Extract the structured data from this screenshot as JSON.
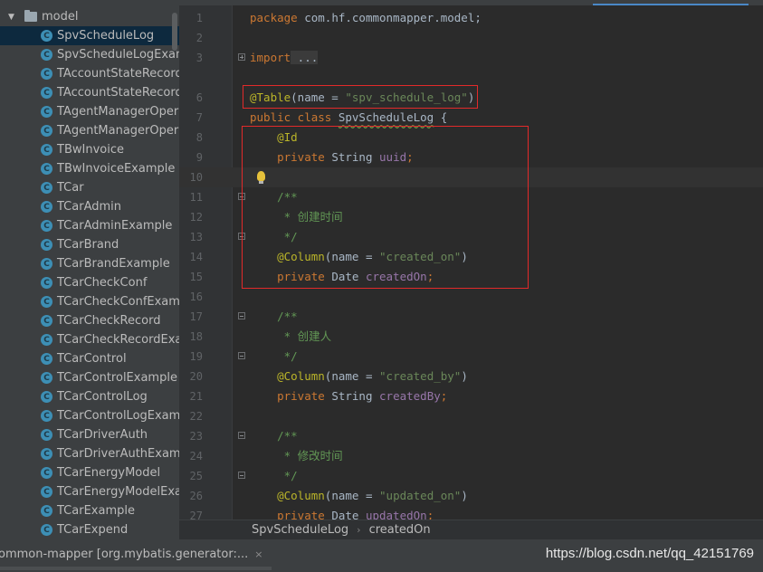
{
  "sidebar": {
    "folder": "model",
    "items": [
      {
        "name": "SpvScheduleLog",
        "selected": true
      },
      {
        "name": "SpvScheduleLogExample",
        "selected": false
      },
      {
        "name": "TAccountStateRecord",
        "selected": false
      },
      {
        "name": "TAccountStateRecordExample",
        "selected": false
      },
      {
        "name": "TAgentManagerOperateLog",
        "selected": false
      },
      {
        "name": "TAgentManagerOperateLogExample",
        "selected": false
      },
      {
        "name": "TBwInvoice",
        "selected": false
      },
      {
        "name": "TBwInvoiceExample",
        "selected": false
      },
      {
        "name": "TCar",
        "selected": false
      },
      {
        "name": "TCarAdmin",
        "selected": false
      },
      {
        "name": "TCarAdminExample",
        "selected": false
      },
      {
        "name": "TCarBrand",
        "selected": false
      },
      {
        "name": "TCarBrandExample",
        "selected": false
      },
      {
        "name": "TCarCheckConf",
        "selected": false
      },
      {
        "name": "TCarCheckConfExample",
        "selected": false
      },
      {
        "name": "TCarCheckRecord",
        "selected": false
      },
      {
        "name": "TCarCheckRecordExample",
        "selected": false
      },
      {
        "name": "TCarControl",
        "selected": false
      },
      {
        "name": "TCarControlExample",
        "selected": false
      },
      {
        "name": "TCarControlLog",
        "selected": false
      },
      {
        "name": "TCarControlLogExample",
        "selected": false
      },
      {
        "name": "TCarDriverAuth",
        "selected": false
      },
      {
        "name": "TCarDriverAuthExample",
        "selected": false
      },
      {
        "name": "TCarEnergyModel",
        "selected": false
      },
      {
        "name": "TCarEnergyModelExample",
        "selected": false
      },
      {
        "name": "TCarExample",
        "selected": false
      },
      {
        "name": "TCarExpend",
        "selected": false
      }
    ],
    "class_icon_letter": "C"
  },
  "code": {
    "line_numbers": [
      "1",
      "2",
      "3",
      "6",
      "7",
      "8",
      "9",
      "10",
      "11",
      "12",
      "13",
      "14",
      "15",
      "16",
      "17",
      "18",
      "19",
      "20",
      "21",
      "22",
      "23",
      "24",
      "25",
      "26",
      "27"
    ],
    "l1": {
      "kw": "package",
      "rest": " com.hf.commonmapper.model;"
    },
    "l3": {
      "kw": "import",
      "rest": " ..."
    },
    "l6": {
      "ann": "@Table",
      "open": "(name = ",
      "str": "\"spv_schedule_log\"",
      "close": ")"
    },
    "l7": {
      "kw": "public class",
      "space": " ",
      "cls": "SpvScheduleLog",
      "rest": " {"
    },
    "l8": {
      "ann": "@Id"
    },
    "l9": {
      "kw": "private",
      "type": " String ",
      "fld": "uuid",
      "end": ";"
    },
    "l11": {
      "cmt": "/**"
    },
    "l12": {
      "cmt": " * 创建时间"
    },
    "l13": {
      "cmt": " */"
    },
    "l14": {
      "ann": "@Column",
      "open": "(name = ",
      "str": "\"created_on\"",
      "close": ")"
    },
    "l15": {
      "kw": "private",
      "type": " Date ",
      "fld": "createdOn",
      "end": ";"
    },
    "l17": {
      "cmt": "/**"
    },
    "l18": {
      "cmt": " * 创建人"
    },
    "l19": {
      "cmt": " */"
    },
    "l20": {
      "ann": "@Column",
      "open": "(name = ",
      "str": "\"created_by\"",
      "close": ")"
    },
    "l21": {
      "kw": "private",
      "type": " String ",
      "fld": "createdBy",
      "end": ";"
    },
    "l23": {
      "cmt": "/**"
    },
    "l24": {
      "cmt": " * 修改时间"
    },
    "l25": {
      "cmt": " */"
    },
    "l26": {
      "ann": "@Column",
      "open": "(name = ",
      "str": "\"updated_on\"",
      "close": ")"
    },
    "l27": {
      "kw": "private",
      "type": " Date ",
      "fld": "updatedOn",
      "end": ";"
    }
  },
  "breadcrumb": {
    "class": "SpvScheduleLog",
    "member": "createdOn",
    "separator": "›"
  },
  "run_tab": {
    "label": "ommon-mapper [org.mybatis.generator:...",
    "close": "×"
  },
  "watermark": "https://blog.csdn.net/qq_42151769",
  "colors": {
    "annotation": "#bbb529",
    "keyword": "#cc7832",
    "string": "#6a8759",
    "comment": "#629755",
    "field": "#9876aa",
    "highlight_box": "#e22a2a"
  }
}
